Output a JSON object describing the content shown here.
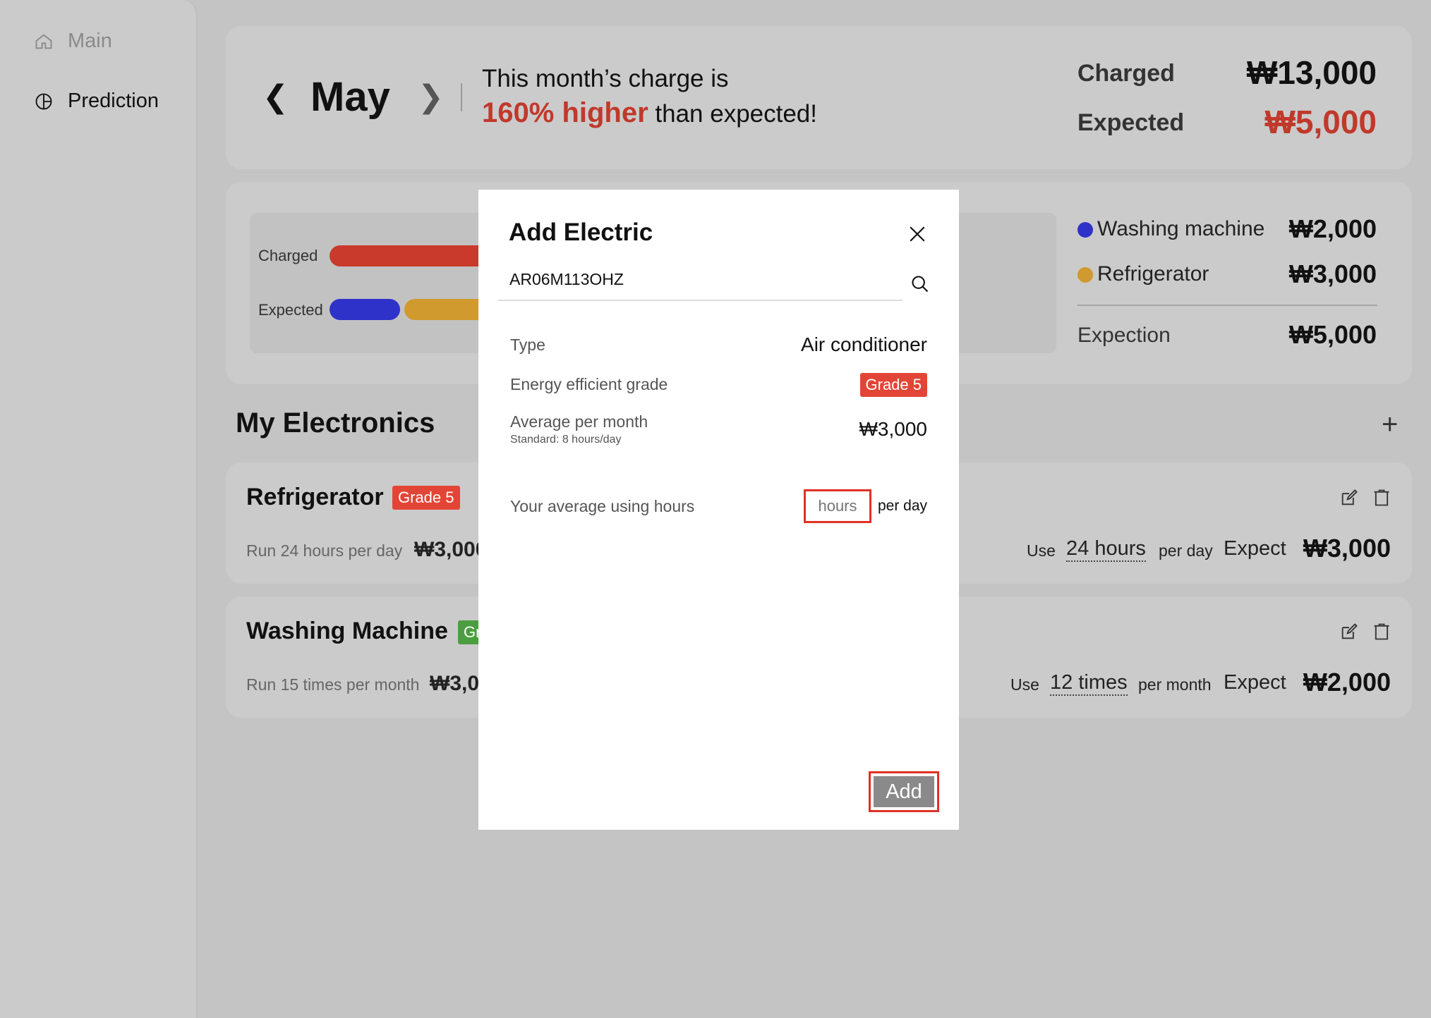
{
  "sidebar": {
    "items": [
      {
        "label": "Main",
        "icon": "home-icon"
      },
      {
        "label": "Prediction",
        "icon": "pie-chart-icon"
      }
    ]
  },
  "summary": {
    "month": "May",
    "line1": "This month’s charge is",
    "highlight": "160% higher",
    "line2_rest": " than expected!",
    "charged_label": "Charged",
    "charged_value": "₩13,000",
    "expected_label": "Expected",
    "expected_value": "₩5,000"
  },
  "chart": {
    "charged_label": "Charged",
    "expected_label": "Expected",
    "legend": [
      {
        "name": "Washing machine",
        "value": "₩2,000",
        "color": "#2f32c9"
      },
      {
        "name": "Refrigerator",
        "value": "₩3,000",
        "color": "#d19a2e"
      }
    ],
    "expection_label": "Expection",
    "expection_value": "₩5,000",
    "colors": {
      "charged": "#c93a2c",
      "washing": "#2f32c9",
      "refrigerator": "#d19a2e"
    }
  },
  "electronics": {
    "title": "My Electronics",
    "items": [
      {
        "name": "Refrigerator",
        "grade": "Grade 5",
        "run": "Run 24 hours per day",
        "price": "₩3,000",
        "use_prefix": "Use",
        "use_value": "24 hours",
        "use_suffix": "per day",
        "expect_label": "Expect",
        "expect_value": "₩3,000"
      },
      {
        "name": "Washing Machine",
        "grade": "Gr",
        "run": "Run 15 times per month",
        "price": "₩3,0",
        "use_prefix": "Use",
        "use_value": "12 times",
        "use_suffix": "per month",
        "expect_label": "Expect",
        "expect_value": "₩2,000"
      }
    ]
  },
  "modal": {
    "title": "Add Electric",
    "search_value": "AR06M113OHZ",
    "type_label": "Type",
    "type_value": "Air conditioner",
    "grade_label": "Energy efficient grade",
    "grade_value": "Grade 5",
    "avg_label": "Average per month",
    "avg_sub": "Standard: 8 hours/day",
    "avg_value": "₩3,000",
    "hours_label": "Your average using hours",
    "hours_placeholder": "hours",
    "per_day": "per day",
    "add_label": "Add"
  }
}
